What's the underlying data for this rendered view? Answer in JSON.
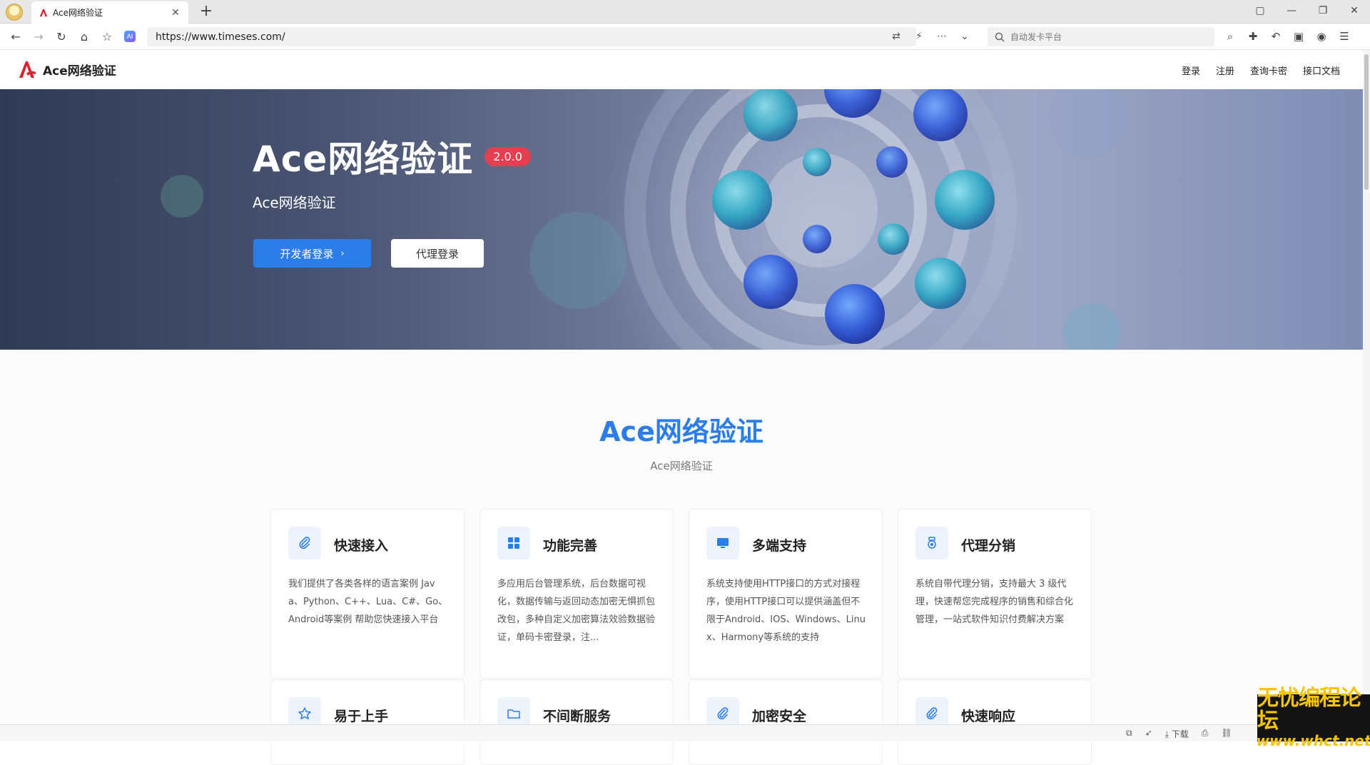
{
  "browser": {
    "tab_title": "Ace网络验证",
    "url": "https://www.timeses.com/",
    "search_placeholder": "自动发卡平台"
  },
  "site": {
    "brand": "Ace网络验证",
    "nav": [
      "登录",
      "注册",
      "查询卡密",
      "接口文档"
    ]
  },
  "hero": {
    "title": "Ace网络验证",
    "version": "2.0.0",
    "subtitle": "Ace网络验证",
    "primary_button": "开发者登录",
    "secondary_button": "代理登录"
  },
  "features": {
    "title": "Ace网络验证",
    "subtitle": "Ace网络验证",
    "cards": [
      {
        "icon": "paperclip-icon",
        "title": "快速接入",
        "desc": "我们提供了各类各样的语言案例 Java、Python、C++、Lua、C#、Go、Android等案例 帮助您快速接入平台"
      },
      {
        "icon": "grid-icon",
        "title": "功能完善",
        "desc": "多应用后台管理系统，后台数据可视化，数据传输与返回动态加密无惧抓包改包，多种自定义加密算法效验数据验证，单码卡密登录，注..."
      },
      {
        "icon": "monitor-icon",
        "title": "多端支持",
        "desc": "系统支持使用HTTP接口的方式对接程序，使用HTTP接口可以提供涵盖但不限于Android、IOS、Windows、Linux、Harmony等系统的支持"
      },
      {
        "icon": "medal-icon",
        "title": "代理分销",
        "desc": "系统自带代理分销，支持最大 3 级代理，快速帮您完成程序的销售和综合化管理，一站式软件知识付费解决方案"
      },
      {
        "icon": "star-icon",
        "title": "易于上手",
        "desc": ""
      },
      {
        "icon": "folder-icon",
        "title": "不间断服务",
        "desc": ""
      },
      {
        "icon": "paperclip-icon",
        "title": "加密安全",
        "desc": ""
      },
      {
        "icon": "paperclip-icon",
        "title": "快速响应",
        "desc": ""
      }
    ]
  },
  "statusbar": {
    "download_label": "下载"
  },
  "watermark": {
    "line1": "无忧编程论坛",
    "line2": "www.whct.net"
  },
  "colors": {
    "accent": "#2b7de9",
    "badge": "#e53f4f",
    "hero_dark": "#2f3a55"
  }
}
